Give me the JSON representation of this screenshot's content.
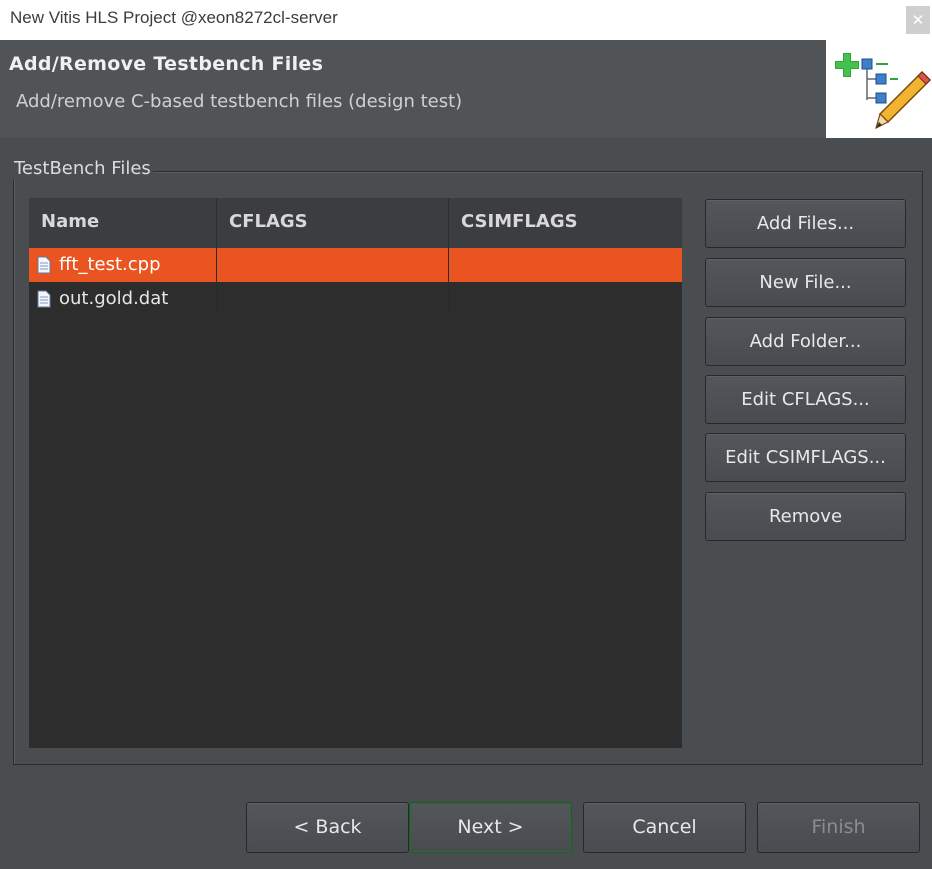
{
  "window": {
    "title": "New Vitis HLS Project @xeon8272cl-server",
    "close_glyph": "✕"
  },
  "header": {
    "title": "Add/Remove Testbench Files",
    "subtitle": "Add/remove C-based testbench files (design test)",
    "banner_icon": "wizard-banner-icon"
  },
  "group": {
    "label": "TestBench Files"
  },
  "table": {
    "columns": [
      "Name",
      "CFLAGS",
      "CSIMFLAGS"
    ],
    "rows": [
      {
        "name": "fft_test.cpp",
        "cflags": "",
        "csimflags": "",
        "selected": true,
        "icon": "file-icon"
      },
      {
        "name": "out.gold.dat",
        "cflags": "",
        "csimflags": "",
        "selected": false,
        "icon": "file-icon"
      }
    ]
  },
  "side_buttons": {
    "add_files": "Add Files...",
    "new_file": "New File...",
    "add_folder": "Add Folder...",
    "edit_cflags": "Edit CFLAGS...",
    "edit_csimflags": "Edit CSIMFLAGS...",
    "remove": "Remove"
  },
  "footer": {
    "back": "< Back",
    "next": "Next >",
    "cancel": "Cancel",
    "finish": "Finish"
  },
  "colors": {
    "selection": "#e95420",
    "background": "#4a4d50",
    "table_bg": "#2d2d2d"
  }
}
